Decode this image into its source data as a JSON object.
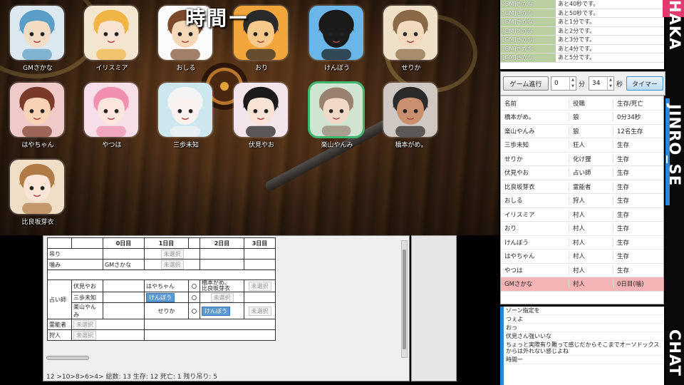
{
  "title": "時間ー",
  "players": [
    {
      "name": "GMさかな",
      "bg": "#dce8ef",
      "face": "#f3dcc4",
      "hair": "#5a9ec7"
    },
    {
      "name": "イリスミア",
      "bg": "#f3e6cf",
      "face": "#f8e3d1",
      "hair": "#f0b545"
    },
    {
      "name": "おしる",
      "bg": "#fbfbfb",
      "face": "#f5d8b8",
      "hair": "#7a4a2a"
    },
    {
      "name": "おり",
      "bg": "#f2a53a",
      "face": "#f7c98a",
      "hair": "#2a2a2a"
    },
    {
      "name": "けんぼう",
      "bg": "#6ab6e8",
      "face": "#1a1a1a",
      "hair": "#1a1a1a"
    },
    {
      "name": "せりか",
      "bg": "#efe0c8",
      "face": "#f3d9bd",
      "hair": "#8a6a46"
    },
    {
      "name": "はやちゃん",
      "bg": "#f0c9c9",
      "face": "#f7d2b4",
      "hair": "#7a3a2a"
    },
    {
      "name": "やつは",
      "bg": "#f6dfe8",
      "face": "#fbe5dc",
      "hair": "#f08fb0"
    },
    {
      "name": "三歩未知",
      "bg": "#cde7ef",
      "face": "#fbf2ef",
      "hair": "#f4f4f4"
    },
    {
      "name": "伏見やお",
      "bg": "#f4e4ec",
      "face": "#f9e3d6",
      "hair": "#1a1a1a"
    },
    {
      "name": "楽山やんみ",
      "bg": "#cfe5d2",
      "face": "#f0d9c6",
      "hair": "#9a8070"
    },
    {
      "name": "橋本がめ。",
      "bg": "#cfc7c2",
      "face": "#c98f6f",
      "hair": "#2a2a2a"
    },
    {
      "name": "比良坂芽衣",
      "bg": "#f0dec7",
      "face": "#fae5d6",
      "hair": "#b07a44"
    }
  ],
  "vote": {
    "days": [
      "0日目",
      "1日目",
      "2日目",
      "3日目"
    ],
    "rows": {
      "hang": "吊り",
      "bite": "噛み",
      "seer": "占い師",
      "medium": "霊能者",
      "hunter": "狩人"
    },
    "unselected": "未選択",
    "bite_day0": "GMさかな",
    "seers": [
      {
        "name": "伏見やお",
        "d1": "はやちゃん",
        "d2a": "橋本がめ。",
        "d2b": "比良坂芽衣"
      },
      {
        "name": "三歩未知",
        "d1": "けんぼう"
      },
      {
        "name": "楽山やんみ",
        "d1": "せりか",
        "d2": "けんぼう"
      }
    ],
    "status_line": "12 >10>8>6>4> 総数: 13 生存: 12 死亡: 1 残り吊り: 5"
  },
  "log": [
    {
      "who": "[GM]さかな",
      "msg": "あと40秒です。"
    },
    {
      "who": "[GM]さかな",
      "msg": "あと50秒です。"
    },
    {
      "who": "[GM]さかな",
      "msg": "あと1分です。"
    },
    {
      "who": "[GM]さかな",
      "msg": "あと2分です。"
    },
    {
      "who": "[GM]さかな",
      "msg": "あと3分です。"
    },
    {
      "who": "[GM]さかな",
      "msg": "あと4分です。"
    },
    {
      "who": "[GM]さかな",
      "msg": "あと5分です。"
    }
  ],
  "timer": {
    "advance_label": "ゲーム進行",
    "minutes": "0",
    "min_label": "分",
    "seconds": "34",
    "sec_label": "秒",
    "timer_label": "タイマー"
  },
  "status_table": {
    "headers": [
      "名前",
      "役職",
      "生存/死亡"
    ],
    "rows": [
      {
        "name": "橋本がめ。",
        "role": "狼",
        "state": "0分34秒"
      },
      {
        "name": "楽山やんみ",
        "role": "狼",
        "state": "12名生存"
      },
      {
        "name": "三歩未知",
        "role": "狂人",
        "state": "生存"
      },
      {
        "name": "せりか",
        "role": "化け狸",
        "state": "生存"
      },
      {
        "name": "伏見やお",
        "role": "占い師",
        "state": "生存"
      },
      {
        "name": "比良坂芽衣",
        "role": "霊能者",
        "state": "生存"
      },
      {
        "name": "おしる",
        "role": "狩人",
        "state": "生存"
      },
      {
        "name": "イリスミア",
        "role": "村人",
        "state": "生存"
      },
      {
        "name": "おり",
        "role": "村人",
        "state": "生存"
      },
      {
        "name": "けんぼう",
        "role": "村人",
        "state": "生存"
      },
      {
        "name": "はやちゃん",
        "role": "村人",
        "state": "生存"
      },
      {
        "name": "やつは",
        "role": "村人",
        "state": "生存"
      },
      {
        "name": "GMさかな",
        "role": "村人",
        "state": "0日目(噛)",
        "dead": true
      }
    ]
  },
  "chat": [
    "ゾーン指定を",
    "つぇよ",
    "おっ",
    "伏見さん強いいな",
    "ちょっと実際有り難って感じだからそこまでオーソドックスからは外れない感じよね",
    "時間ー"
  ],
  "banner": {
    "top": "HAKA",
    "middle": "JINRO_SE",
    "bottom": "CHAT"
  },
  "colors": {
    "accent_pink": "#e03a6e",
    "accent_blue": "#2b86d6",
    "dead_row": "#f4b4b6",
    "selected_border": "#3fb66b"
  }
}
